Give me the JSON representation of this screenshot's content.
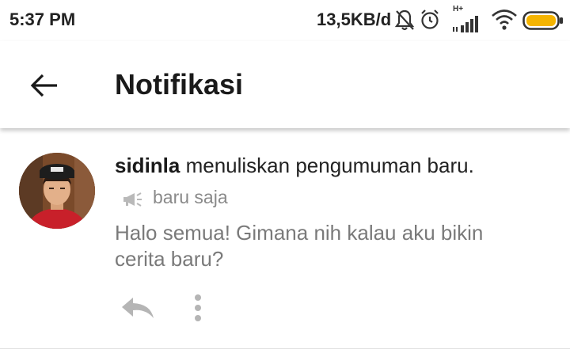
{
  "status_bar": {
    "time": "5:37 PM",
    "network_speed": "13,5KB/d",
    "icons": [
      "bell-muted-icon",
      "alarm-icon",
      "signal-icon",
      "wifi-icon",
      "battery-icon"
    ],
    "signal_label": "H+",
    "battery_color": "#f5b400"
  },
  "app_bar": {
    "title": "Notifikasi",
    "back_icon": "arrow-left-icon"
  },
  "notification": {
    "username": "sidinla",
    "action_text": " menuliskan pengumuman baru.",
    "time": "baru saja",
    "type_icon": "megaphone-icon",
    "message": "Halo semua! Gimana nih kalau aku bikin cerita baru?",
    "actions": [
      "reply-icon",
      "more-vert-icon"
    ]
  }
}
